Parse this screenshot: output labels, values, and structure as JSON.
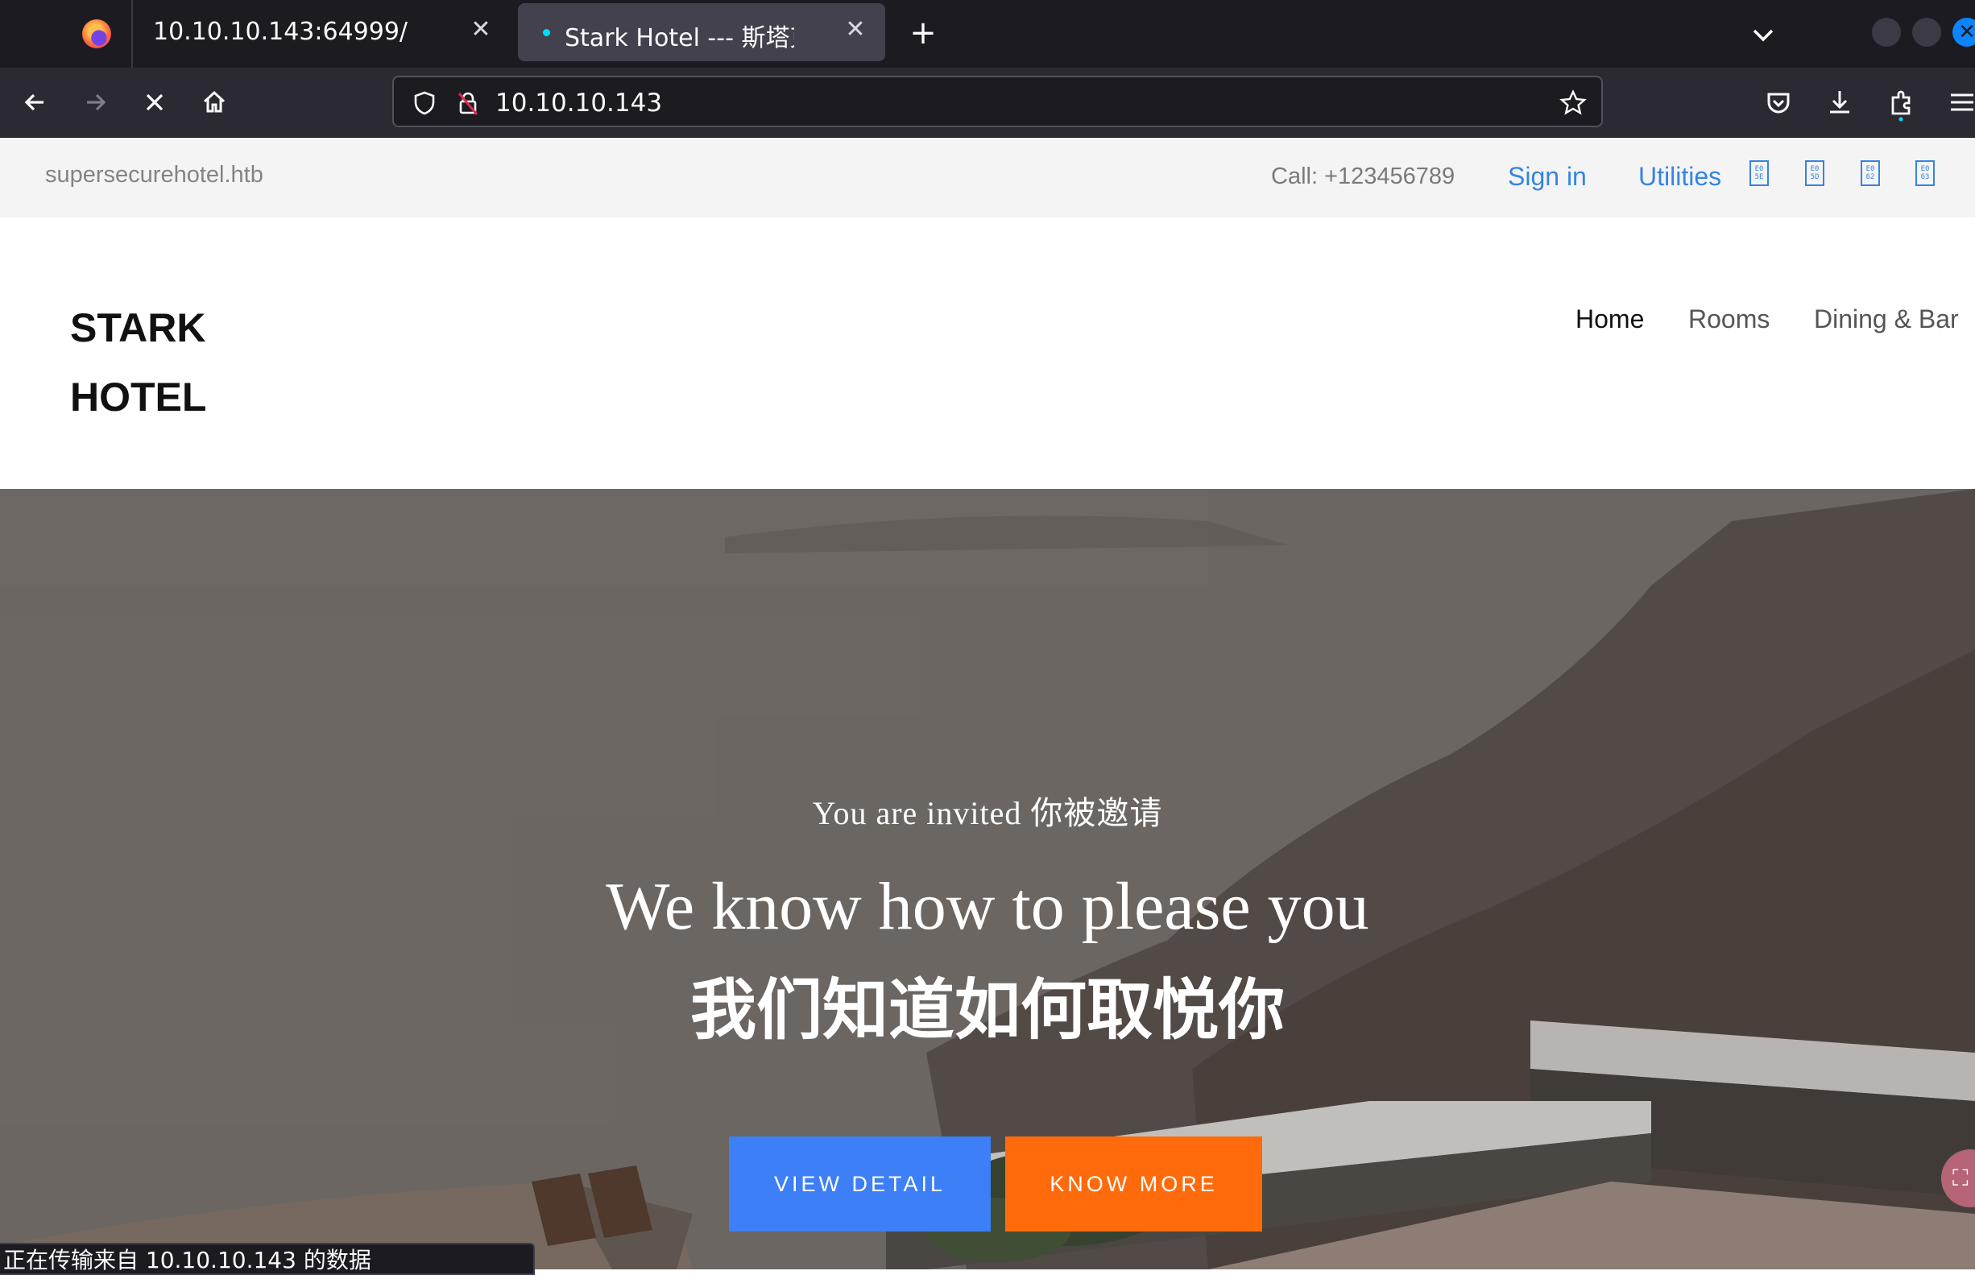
{
  "browser": {
    "tabs": [
      {
        "title": "10.10.10.143:64999/"
      },
      {
        "title": "Stark Hotel --- 斯塔克酒店"
      }
    ],
    "url": "10.10.10.143",
    "status_text": "正在传输来自 10.10.10.143 的数据"
  },
  "topbar": {
    "domain": "supersecurehotel.htb",
    "phone": "Call: +123456789",
    "sign_in": "Sign in",
    "utilities": "Utilities",
    "glyph_boxes": [
      "E0\n5E",
      "E0\n5D",
      "E0\n62",
      "E0\n63"
    ]
  },
  "header": {
    "logo_line1": "STARK",
    "logo_line2": "HOTEL",
    "menu": [
      "Home",
      "Rooms",
      "Dining & Bar"
    ]
  },
  "hero": {
    "invited": "You are invited 你被邀请",
    "headline_en": "We know how to please you",
    "headline_zh": "我们知道如何取悦你",
    "view_detail": "VIEW DETAIL",
    "know_more": "KNOW MORE"
  },
  "colors": {
    "link": "#3584e4",
    "primary_button": "#3d7ff6",
    "secondary_button": "#ff6b0b",
    "browser_dark": "#1c1b22"
  }
}
